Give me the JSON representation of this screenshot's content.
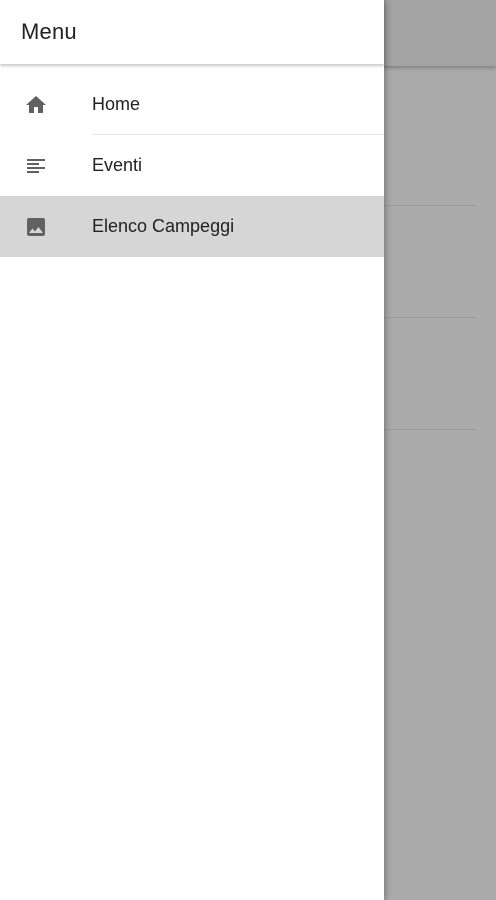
{
  "drawer": {
    "title": "Menu"
  },
  "menu": {
    "items": [
      {
        "label": "Home",
        "icon": "home-icon",
        "selected": false
      },
      {
        "label": "Eventi",
        "icon": "notes-icon",
        "selected": false
      },
      {
        "label": "Elenco Campeggi",
        "icon": "image-icon",
        "selected": true
      }
    ]
  },
  "colors": {
    "scrim": "#ababab",
    "drawer_bg": "#ffffff",
    "selected_bg": "#d6d6d6",
    "icon": "#616161",
    "text": "#222222"
  }
}
